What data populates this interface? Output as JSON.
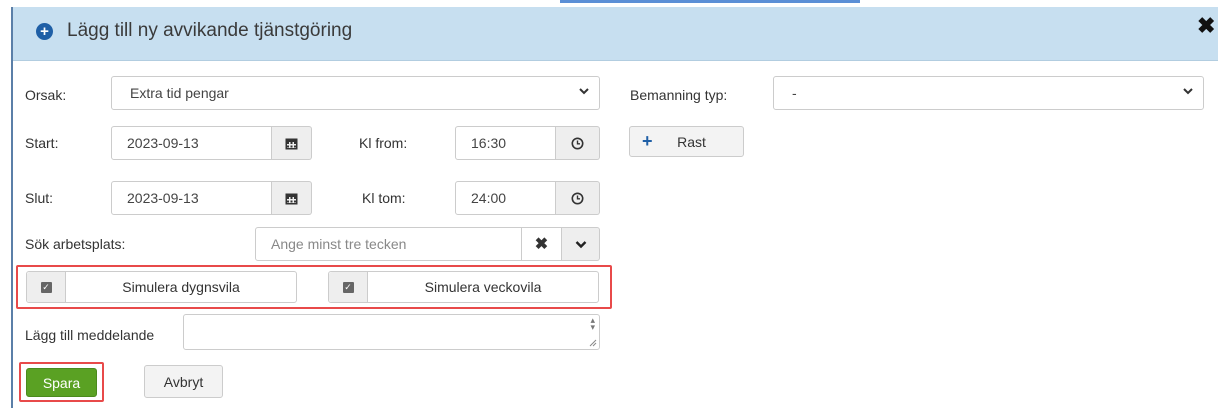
{
  "dialog": {
    "title": "Lägg till ny avvikande tjänstgöring",
    "close_glyph": "✖"
  },
  "orsak": {
    "label": "Orsak:",
    "value": "Extra tid pengar"
  },
  "bemanning": {
    "label": "Bemanning typ:",
    "value": "-"
  },
  "start": {
    "label": "Start:",
    "date": "2023-09-13",
    "time_label": "Kl from:",
    "time": "16:30"
  },
  "slut": {
    "label": "Slut:",
    "date": "2023-09-13",
    "time_label": "Kl tom:",
    "time": "24:00"
  },
  "rast_button": {
    "label": "Rast"
  },
  "arbetsplats": {
    "label": "Sök arbetsplats:",
    "placeholder": "Ange minst tre tecken"
  },
  "simulera_dygnsvila": {
    "label": "Simulera dygnsvila",
    "checked": true
  },
  "simulera_veckovila": {
    "label": "Simulera veckovila",
    "checked": true
  },
  "meddelande": {
    "label": "Lägg till meddelande",
    "value": ""
  },
  "actions": {
    "save_label": "Spara",
    "cancel_label": "Avbryt"
  },
  "colors": {
    "header_bg": "#c7dff0",
    "accent": "#1f5fa6",
    "save_green": "#5aa123",
    "highlight_red": "#e84a4a"
  },
  "icons": {
    "calendar": "calendar-icon",
    "clock": "clock-icon",
    "plus": "plus-icon",
    "clear": "clear-icon",
    "dropdown": "chevron-down-icon"
  }
}
